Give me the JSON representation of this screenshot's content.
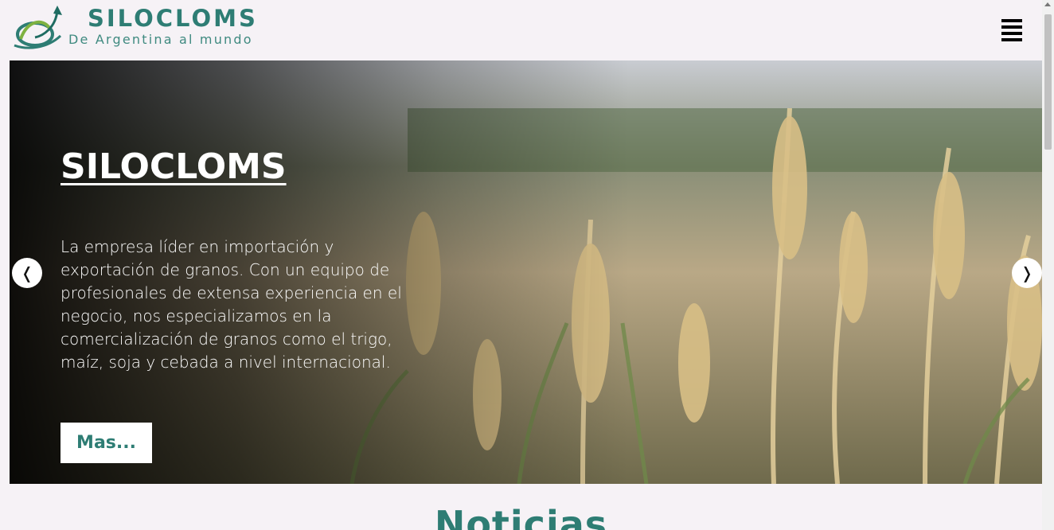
{
  "header": {
    "brand_name": "SILOCLOMS",
    "tagline": "De Argentina al mundo",
    "logo_icon": "swirl-arrow-logo",
    "menu_icon": "hamburger-menu-icon"
  },
  "hero": {
    "title": "SILOCLOMS",
    "description": "La empresa líder en importación y exportación de granos. Con un equipo de profesionales de extensa experiencia en el negocio, nos especializamos en la comercialización de granos como el trigo, maíz, soja y cebada a nivel internacional.",
    "button_label": "Mas...",
    "prev_arrow": "❬",
    "next_arrow": "❭"
  },
  "next_section": {
    "title": "Noticias"
  },
  "colors": {
    "brand_teal": "#2e7d74",
    "page_bg": "#f6f2f6"
  }
}
